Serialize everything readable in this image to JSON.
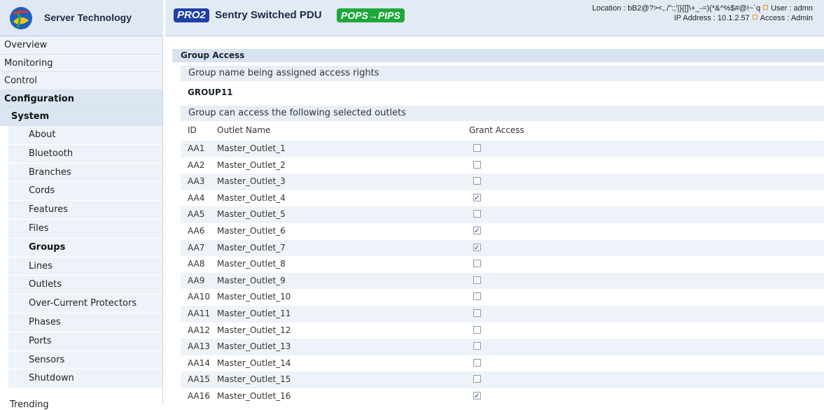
{
  "brand": {
    "name": "Server Technology"
  },
  "header": {
    "badge_left": "PRO2",
    "product": "Sentry Switched PDU",
    "badge_right": "POPS→PIPS",
    "location_label": "Location : bB2@?><,./\":;'|}{[]\\+_-=)(*&^%$#@!~`q",
    "user_label": "User : admn",
    "ip_label": "IP Address : 10.1.2.57",
    "access_label": "Access : Admin"
  },
  "nav": {
    "top": [
      "Overview",
      "Monitoring",
      "Control",
      "Configuration"
    ],
    "system": "System",
    "sub": [
      "About",
      "Bluetooth",
      "Branches",
      "Cords",
      "Features",
      "Files",
      "Groups",
      "Lines",
      "Outlets",
      "Over-Current Protectors",
      "Phases",
      "Ports",
      "Sensors",
      "Shutdown"
    ],
    "trending": "Trending"
  },
  "main": {
    "section_title": "Group Access",
    "group_name_heading": "Group name being assigned access rights",
    "group_name": "GROUP11",
    "outlets_heading": "Group can access the following selected outlets",
    "col_id": "ID",
    "col_name": "Outlet Name",
    "col_access": "Grant Access",
    "outlets": [
      {
        "id": "AA1",
        "name": "Master_Outlet_1",
        "granted": false
      },
      {
        "id": "AA2",
        "name": "Master_Outlet_2",
        "granted": false
      },
      {
        "id": "AA3",
        "name": "Master_Outlet_3",
        "granted": false
      },
      {
        "id": "AA4",
        "name": "Master_Outlet_4",
        "granted": true
      },
      {
        "id": "AA5",
        "name": "Master_Outlet_5",
        "granted": false
      },
      {
        "id": "AA6",
        "name": "Master_Outlet_6",
        "granted": true
      },
      {
        "id": "AA7",
        "name": "Master_Outlet_7",
        "granted": true
      },
      {
        "id": "AA8",
        "name": "Master_Outlet_8",
        "granted": false
      },
      {
        "id": "AA9",
        "name": "Master_Outlet_9",
        "granted": false
      },
      {
        "id": "AA10",
        "name": "Master_Outlet_10",
        "granted": false
      },
      {
        "id": "AA11",
        "name": "Master_Outlet_11",
        "granted": false
      },
      {
        "id": "AA12",
        "name": "Master_Outlet_12",
        "granted": false
      },
      {
        "id": "AA13",
        "name": "Master_Outlet_13",
        "granted": false
      },
      {
        "id": "AA14",
        "name": "Master_Outlet_14",
        "granted": false
      },
      {
        "id": "AA15",
        "name": "Master_Outlet_15",
        "granted": false
      },
      {
        "id": "AA16",
        "name": "Master_Outlet_16",
        "granted": true
      }
    ]
  },
  "colors": {
    "accent": "#1f3fa8",
    "brand_green": "#1ea83c",
    "panel": "#e7eef6"
  }
}
